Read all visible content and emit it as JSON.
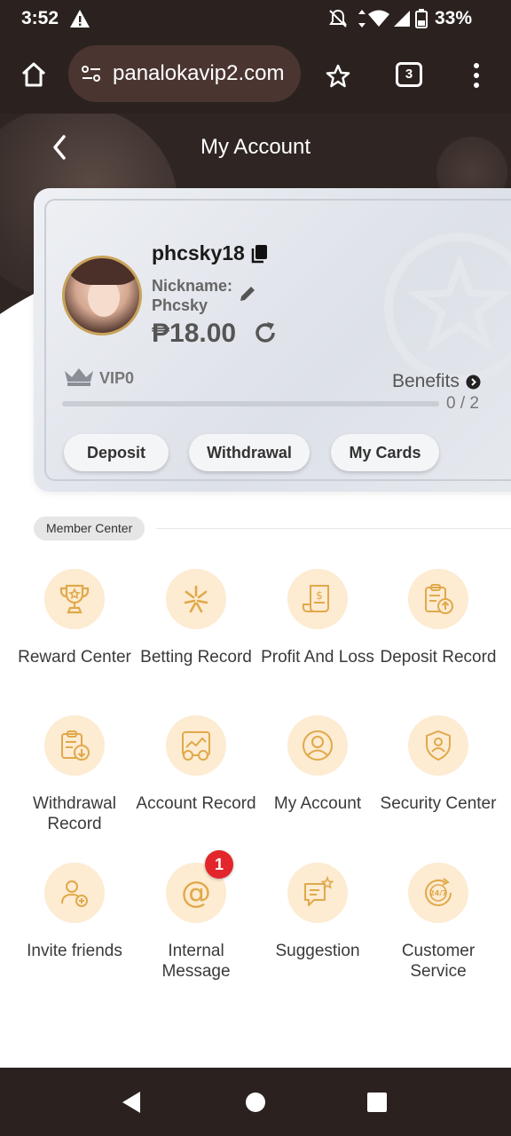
{
  "status_bar": {
    "time": "3:52",
    "battery": "33%"
  },
  "browser": {
    "url": "panalokavip2.com",
    "tab_count": "3"
  },
  "header": {
    "title": "My Account"
  },
  "profile": {
    "username": "phcsky18",
    "nickname_label": "Nickname:",
    "nickname": "Phcsky",
    "balance": "₱18.00",
    "vip_level": "VIP0",
    "benefits_label": "Benefits",
    "progress_text": "0 / 2",
    "progress_fraction": 0.0
  },
  "card_buttons": {
    "deposit": "Deposit",
    "withdrawal": "Withdrawal",
    "my_cards": "My Cards"
  },
  "member_center": {
    "section_title": "Member Center",
    "items": [
      {
        "label": "Reward Center",
        "icon": "trophy-icon"
      },
      {
        "label": "Betting Record",
        "icon": "betting-record-icon"
      },
      {
        "label": "Profit And Loss",
        "icon": "profit-loss-icon"
      },
      {
        "label": "Deposit Record",
        "icon": "deposit-record-icon"
      },
      {
        "label": "Withdrawal Record",
        "icon": "withdrawal-record-icon"
      },
      {
        "label": "Account Record",
        "icon": "account-record-icon"
      },
      {
        "label": "My Account",
        "icon": "user-icon"
      },
      {
        "label": "Security Center",
        "icon": "shield-icon"
      },
      {
        "label": "Invite friends",
        "icon": "invite-friends-icon"
      },
      {
        "label": "Internal Message",
        "icon": "at-sign-icon",
        "badge": "1"
      },
      {
        "label": "Suggestion",
        "icon": "suggestion-icon"
      },
      {
        "label": "Customer Service",
        "icon": "customer-service-24-7-icon"
      }
    ]
  },
  "colors": {
    "dark_bg": "#2b2220",
    "icon_bg": "#fdebd2",
    "icon_stroke": "#e0a94a",
    "badge_red": "#e3262b"
  }
}
